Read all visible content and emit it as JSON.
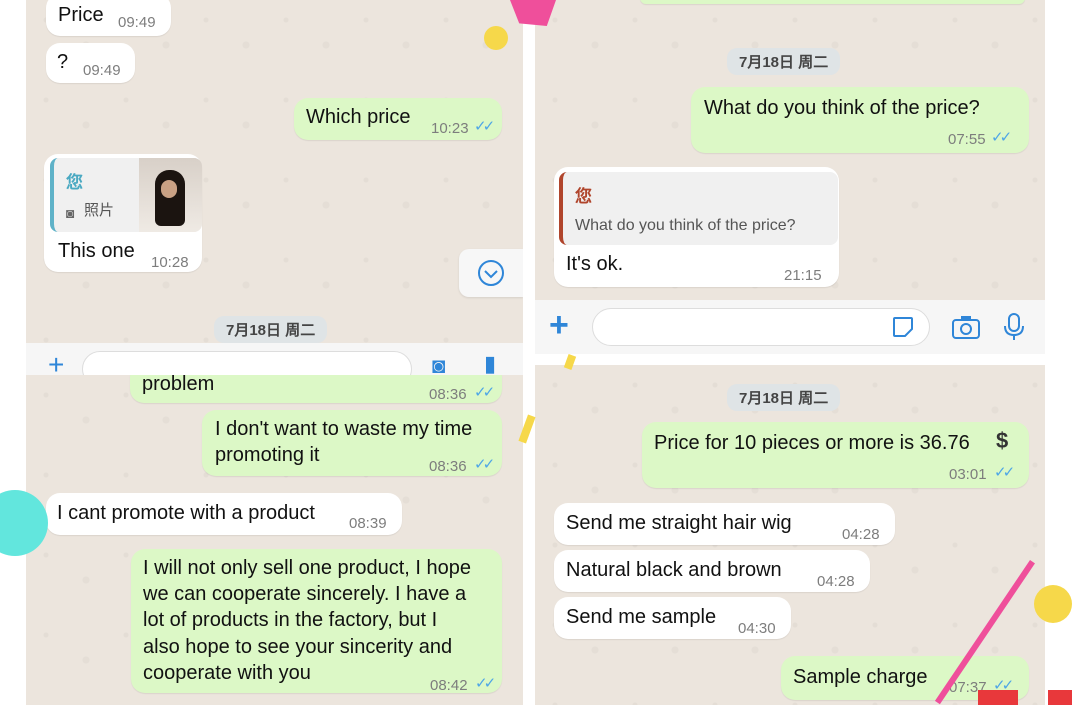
{
  "panel1": {
    "messages": [
      {
        "text": "Price",
        "time": "09:49"
      },
      {
        "text": "?",
        "time": "09:49"
      },
      {
        "text": "Which price",
        "time": "10:23"
      },
      {
        "quote_author": "您",
        "quote_label": "照片",
        "text": "This one",
        "time": "10:28"
      }
    ],
    "date": "7月18日 周二"
  },
  "panel2": {
    "date": "7月18日 周二",
    "messages": [
      {
        "text": "What do you think of the price?",
        "time": "07:55"
      },
      {
        "quote_author": "您",
        "quote_text": "What do you think of the price?",
        "text": "It's ok.",
        "time": "21:15"
      }
    ]
  },
  "panel3": {
    "messages": [
      {
        "text": "problem",
        "time": "08:36"
      },
      {
        "line1": "I don't want to waste my time",
        "line2": "promoting it",
        "time": "08:36"
      },
      {
        "text": "I cant promote with a product",
        "time": "08:39"
      },
      {
        "line1": "I will not only sell one product, I hope",
        "line2": "we can cooperate sincerely. I have a",
        "line3": "lot of products in the factory, but I",
        "line4": "also hope to see your sincerity and",
        "line5": "cooperate with you",
        "time": "08:42"
      }
    ]
  },
  "panel4": {
    "date": "7月18日 周二",
    "messages": [
      {
        "text": "Price for 10 pieces or more is 36.76",
        "dollar": "$",
        "time": "03:01"
      },
      {
        "text": "Send me straight hair wig",
        "time": "04:28"
      },
      {
        "text": "Natural black and brown",
        "time": "04:28"
      },
      {
        "text": "Send me sample",
        "time": "04:30"
      },
      {
        "text": "Sample charge",
        "time": "07:37"
      }
    ]
  },
  "colors": {
    "chat_bg": "#ece5dd",
    "outgoing_bubble": "#dcf8c6",
    "incoming_bubble": "#ffffff",
    "read_ticks": "#4fa6e6",
    "accent_blue": "#2f86d8"
  }
}
